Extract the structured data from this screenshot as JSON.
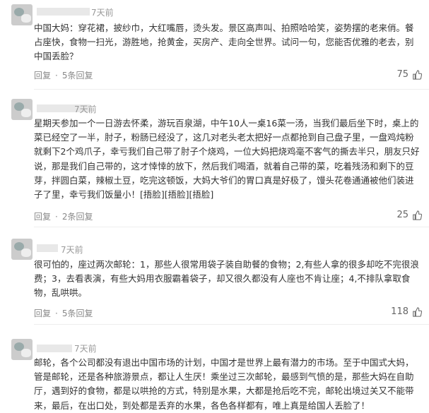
{
  "comments": [
    {
      "time": "7天前",
      "lines": [
        "中国大妈：穿花裙，披纱巾，大红嘴唇，烫头发。景区高声叫、拍照哈哈笑，姿势摆的老来俏。餐",
        "占座快，食物一扫光，游胜地，抢黄金，买房产、走向全世界。试问一句，您能否优雅的老去，别",
        "中国丢脸？"
      ],
      "reply_label": "回复",
      "replies_label": "5条回复",
      "likes": "75"
    },
    {
      "time": "7天前",
      "lines": [
        "星期天参加一个一日游去怀柔，游玩百泉湖，中午10人一桌16菜一汤，当我们最后坐下时，桌上的",
        "菜已经空了一半，肘子，粉肠已经没了，这几对老头老太把好一点都抢到自己盘子里，一盘鸡炖粉",
        "就剩下2个鸡爪子，幸亏我们自己带了肘子个烧鸡，一位大妈把烧鸡毫不客气的撕去半只，朋友只好",
        "说，那是我们自己带的，这才悻悻的放下，然后我们喝酒，就着自己带的菜，吃着残汤和剩下的豆",
        "芽，拌圆白菜，辣椒土豆，吃完这顿饭，大妈大爷们的胃口真是好极了，馒头花卷通通被他们装进",
        "子了里，幸亏我们饭量小！[捂脸][捂脸][捂脸]"
      ],
      "reply_label": "回复",
      "replies_label": "2条回复",
      "likes": "25"
    },
    {
      "time": "7天前",
      "lines": [
        "很可怕的，座过两次邮轮：1，那些人很常用袋子装自助餐的食物；2,有些人拿的很多却吃不完很浪",
        "费；3，去看表演，有些大妈用衣服霸着袋子，却又很久都没有人座也不肯让座；4,不排队拿取食",
        "物，乱哄哄。"
      ],
      "reply_label": "回复",
      "replies_label": "5条回复",
      "likes": "118"
    },
    {
      "time": "7天前",
      "lines": [
        "邮轮，各个公司都没有退出中国市场的计划，中国才是世界上最有潜力的市场。至于中国式大妈，",
        "管是邮轮，还是各种旅游景点，都让人生厌！乘坐过三次邮轮，最感到气愤的是，那些大妈在自助",
        "厅，遇到好的食物，都是以哄抢的方式，特别是水果，大都是抢后吃不完，邮轮出境过关又不能带",
        "来，最后，在出口处，到处都是丢弃的水果，各色各样都有，唯上真是给国人丢脸了！"
      ]
    }
  ]
}
